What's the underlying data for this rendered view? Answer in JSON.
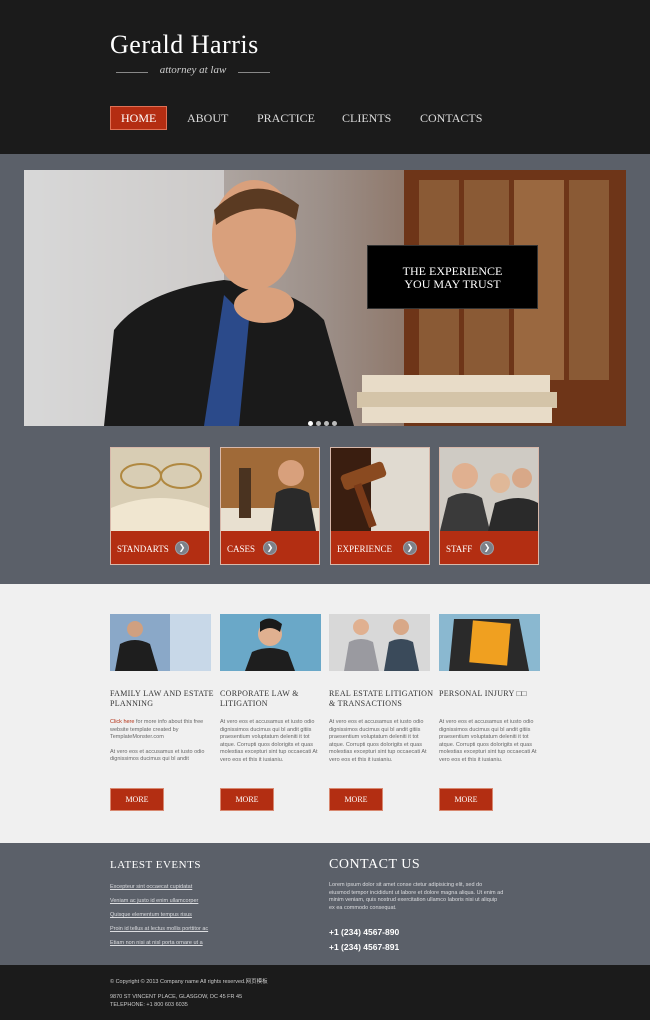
{
  "header": {
    "logo": "Gerald Harris",
    "tagline": "attorney at law"
  },
  "nav": [
    {
      "label": "HOME",
      "active": true
    },
    {
      "label": "ABOUT"
    },
    {
      "label": "PRACTICE"
    },
    {
      "label": "CLIENTS"
    },
    {
      "label": "CONTACTS"
    }
  ],
  "hero": {
    "caption_line1": "THE EXPERIENCE",
    "caption_line2": "YOU MAY TRUST",
    "slide_count": 4,
    "active_slide": 1
  },
  "features": [
    {
      "label": "STANDARTS"
    },
    {
      "label": "CASES"
    },
    {
      "label": "EXPERIENCE"
    },
    {
      "label": "STAFF"
    }
  ],
  "columns": [
    {
      "title": "FAMILY LAW AND ESTATE PLANNING",
      "link_text": "Click here",
      "text1_rest": " for more info about this free website template created by TemplateMonster.com",
      "text2": "At vero eos et accusamus et iusto odio dignissimos ducimus qui bl andit",
      "button": "MORE"
    },
    {
      "title": "CORPORATE LAW & LITIGATION",
      "text1": "At vero eos et accusamus et iusto odio dignissimos ducimus qui bl andit gitiis praesentium voluptatum deleniti it tot atque. Corrupti quos dolorigits et quas molestias excepturi sint tup occaecati At vero eos et this it iusianiu.",
      "button": "MORE"
    },
    {
      "title": "REAL ESTATE LITIGATION & TRANSACTIONS",
      "text1": "At vero eos et accusamus et iusto odio dignissimos ducimus qui bl andit gitiis praesentium voluptatum deleniti it tot atque. Corrupti quos dolorigits et quas molestias excepturi sint tup occaecati At vero eos et this it iusianiu.",
      "button": "MORE"
    },
    {
      "title": "PERSONAL INJURY □□",
      "text1": "At vero eos et accusamus et iusto odio dignissimos ducimus qui bl andit gitiis praesentium voluptatum deleniti it tot atque. Corrupti quos dolorigits et quas molestias excepturi sint tup occaecati At vero eos et this it iusianiu.",
      "button": "MORE"
    }
  ],
  "events": {
    "title": "LATEST EVENTS",
    "items": [
      "Excepteur sint occaecat cupidatat",
      "Veniam ac justo id enim ullamcorper",
      "Quisque elementum tempus risus",
      "Proin id tellus at lectus mollis porttitor ac",
      "Etiam non nisi at nisl porta ornare ut a"
    ]
  },
  "contact": {
    "title": "CONTACT US",
    "text": "Lorem ipsum dolor sit amet conse ctetur adipisicing elit, sed do eiusmod tempor incididunt ut labore et dolore magna aliqua. Ut enim ad minim veniam, quis nostrud exercitation ullamco laboris nisi ut aliquip ex ea commodo consequat.",
    "phone1": "+1 (234) 4567-890",
    "phone2": "+1 (234) 4567-891"
  },
  "bottom": {
    "copyright": "© Copyright © 2013 Company name All rights reserved.网页模板",
    "address": "9870 ST VINCENT PLACE, GLASGOW, DC 45 FR 45",
    "telephone": "TELEPHONE: +1 800 603 6035"
  },
  "colors": {
    "header_bg": "#1b1b1b",
    "band_bg": "#5b6069",
    "accent": "#b32e12",
    "content_bg": "#f0f0f0"
  }
}
